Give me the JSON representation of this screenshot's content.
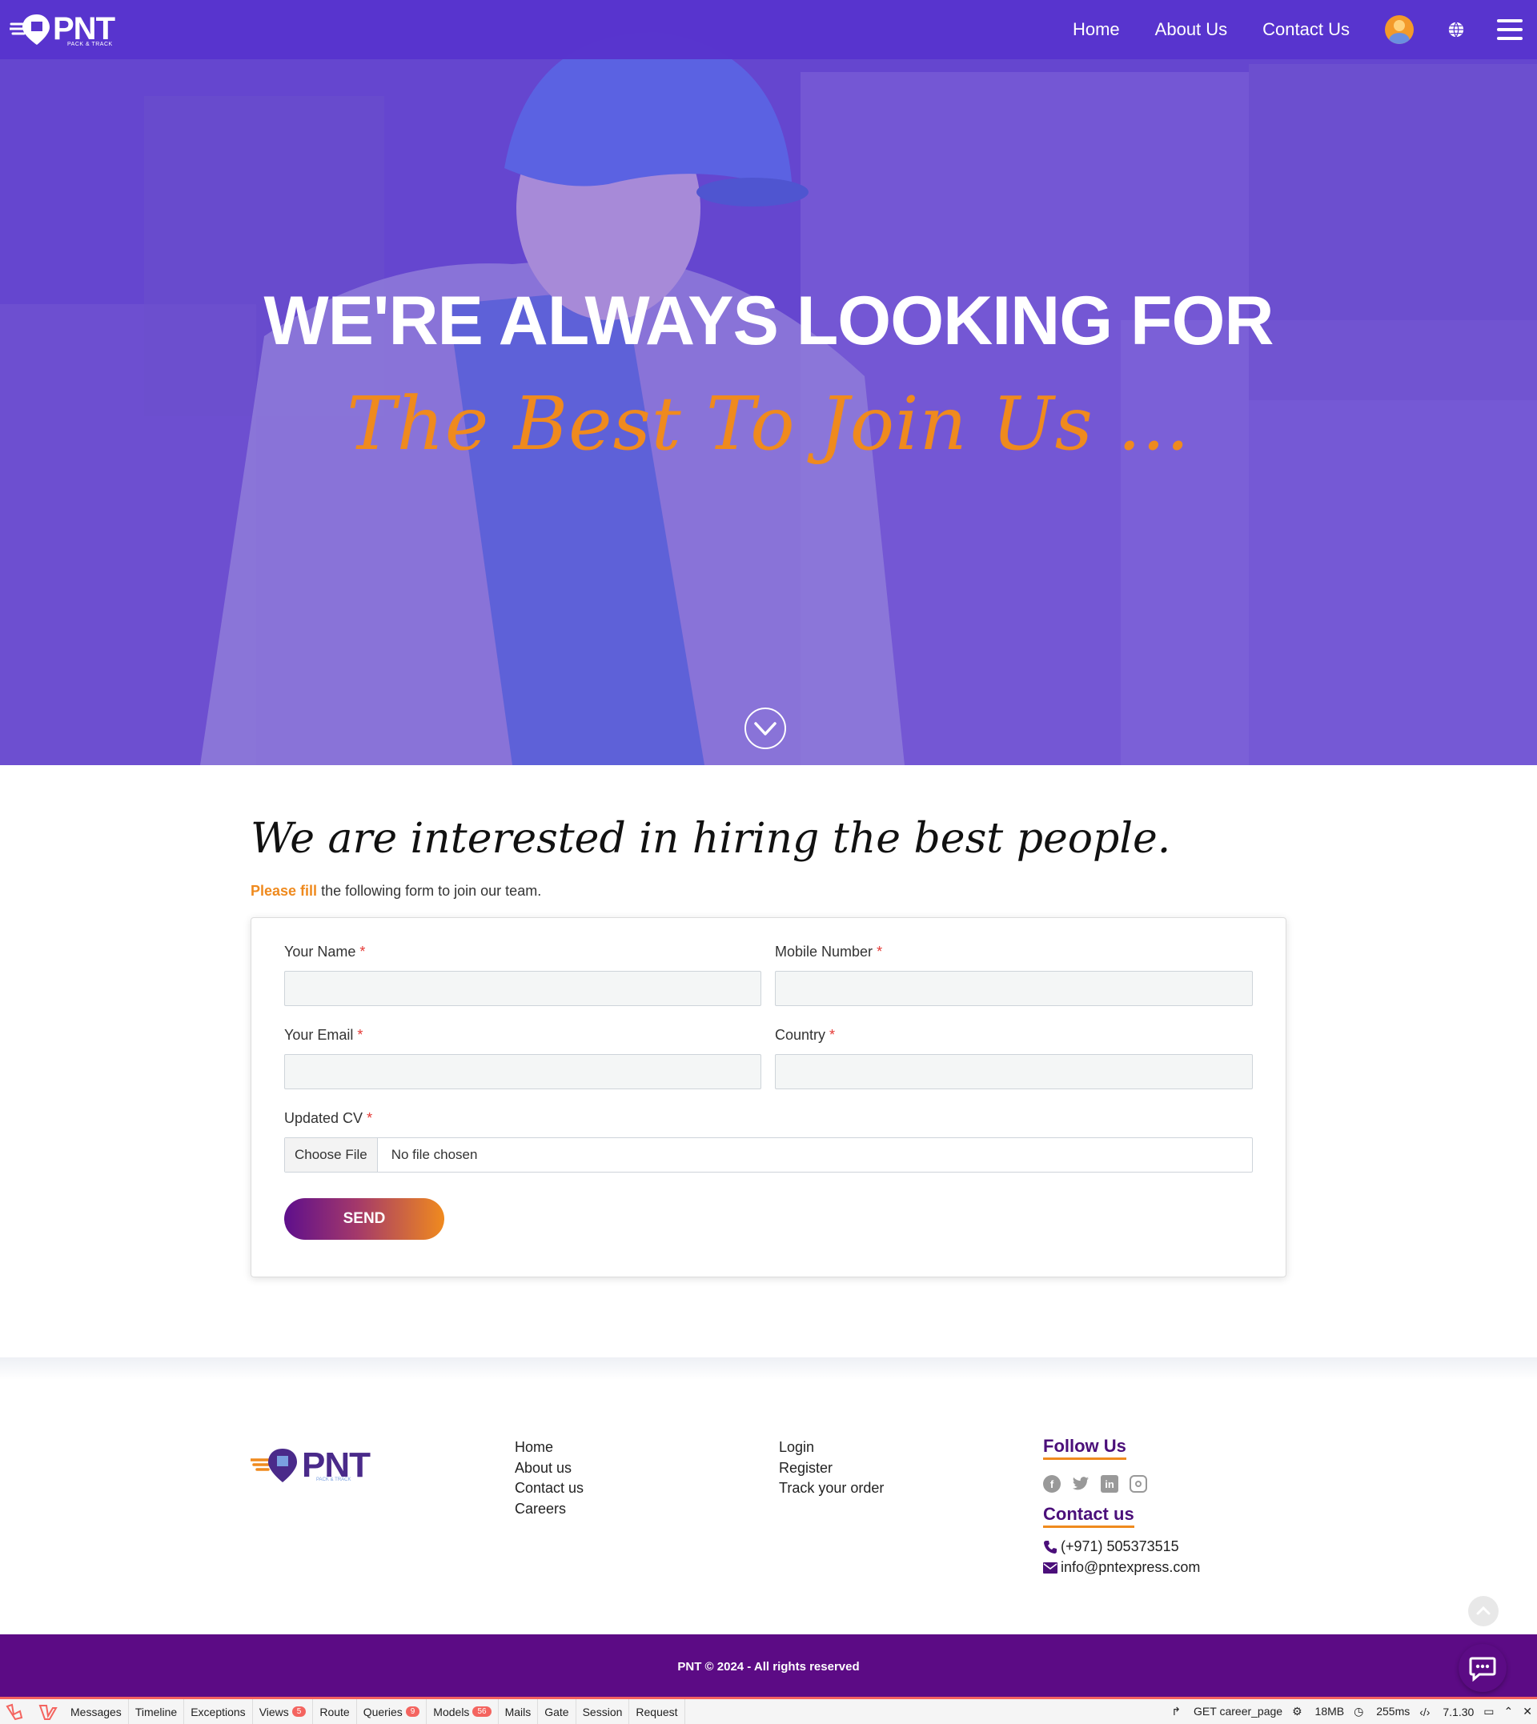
{
  "header": {
    "logo_text": "PNT",
    "logo_tagline": "PACK & TRACK",
    "nav": [
      "Home",
      "About Us",
      "Contact Us"
    ]
  },
  "hero": {
    "title": "WE'RE ALWAYS LOOKING FOR",
    "subtitle": "The Best To Join Us ..."
  },
  "form_section": {
    "title": "We are interested in hiring the best people.",
    "intro_highlight": "Please fill",
    "intro_rest": " the following form to join our team.",
    "fields": {
      "name": "Your Name",
      "mobile": "Mobile Number",
      "email": "Your Email",
      "country": "Country",
      "cv": "Updated CV",
      "required_mark": "*"
    },
    "file_button": "Choose File",
    "file_status": "No file chosen",
    "submit": "SEND"
  },
  "footer": {
    "logo_text": "PNT",
    "logo_tagline": "PACK & TRACK",
    "links_col1": [
      "Home",
      "About us",
      "Contact us",
      "Careers"
    ],
    "links_col2": [
      "Login",
      "Register",
      "Track your order"
    ],
    "follow_heading": "Follow Us",
    "socials": [
      "facebook-icon",
      "twitter-icon",
      "linkedin-icon",
      "instagram-icon"
    ],
    "contact_heading": "Contact us",
    "phone": "(+971) 505373515",
    "email": "info@pntexpress.com",
    "copyright": "PNT © 2024 - All rights reserved"
  },
  "debugbar": {
    "tabs": [
      "Messages",
      "Timeline",
      "Exceptions",
      "Views",
      "Route",
      "Queries",
      "Models",
      "Mails",
      "Gate",
      "Session",
      "Request"
    ],
    "badges": {
      "Views": "5",
      "Queries": "9",
      "Models": "56"
    },
    "request": "GET career_page",
    "memory": "18MB",
    "time": "255ms",
    "version": "7.1.30"
  },
  "colors": {
    "brand_purple": "#5c0b85",
    "hero_overlay": "#6244c9",
    "accent_orange": "#ef8a1e",
    "required_red": "#e53935"
  }
}
